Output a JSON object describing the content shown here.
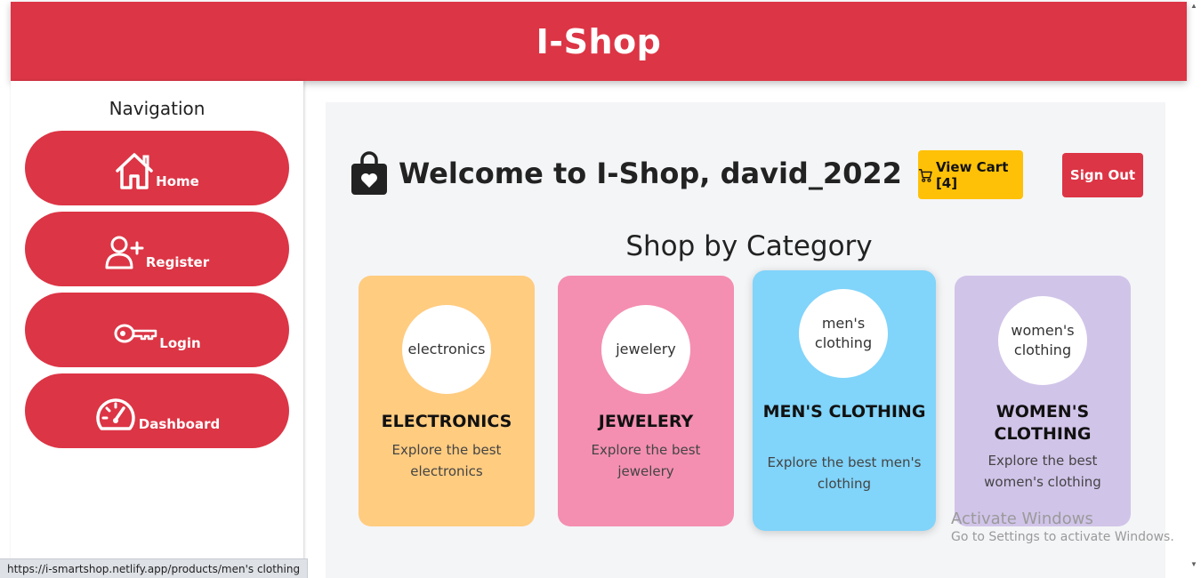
{
  "header": {
    "title": "I-Shop"
  },
  "sidebar": {
    "title": "Navigation",
    "items": [
      {
        "label": "Home",
        "icon": "home-icon"
      },
      {
        "label": "Register",
        "icon": "user-plus-icon"
      },
      {
        "label": "Login",
        "icon": "key-icon"
      },
      {
        "label": "Dashboard",
        "icon": "speedometer-icon"
      }
    ]
  },
  "main": {
    "welcome": "Welcome to I-Shop, david_2022",
    "cart_label": "View Cart [4]",
    "signout_label": "Sign Out",
    "section_title": "Shop by Category",
    "categories": [
      {
        "image_alt": "electronics",
        "title": "ELECTRONICS",
        "description": "Explore the best electronics",
        "color": "#ffcc80"
      },
      {
        "image_alt": "jewelery",
        "title": "JEWELERY",
        "description": "Explore the best jewelery",
        "color": "#f48fb1"
      },
      {
        "image_alt": "men's clothing",
        "title": "MEN'S CLOTHING",
        "description": "Explore the best men's clothing",
        "color": "#81d4fa"
      },
      {
        "image_alt": "women's clothing",
        "title": "WOMEN'S CLOTHING",
        "description": "Explore the best women's clothing",
        "color": "#d1c4e9"
      }
    ]
  },
  "watermark": {
    "line1": "Activate Windows",
    "line2": "Go to Settings to activate Windows."
  },
  "statusbar": {
    "url": "https://i-smartshop.netlify.app/products/men's clothing"
  },
  "colors": {
    "primary": "#dc3545",
    "warning": "#ffc107",
    "panel": "#f4f5f7"
  }
}
